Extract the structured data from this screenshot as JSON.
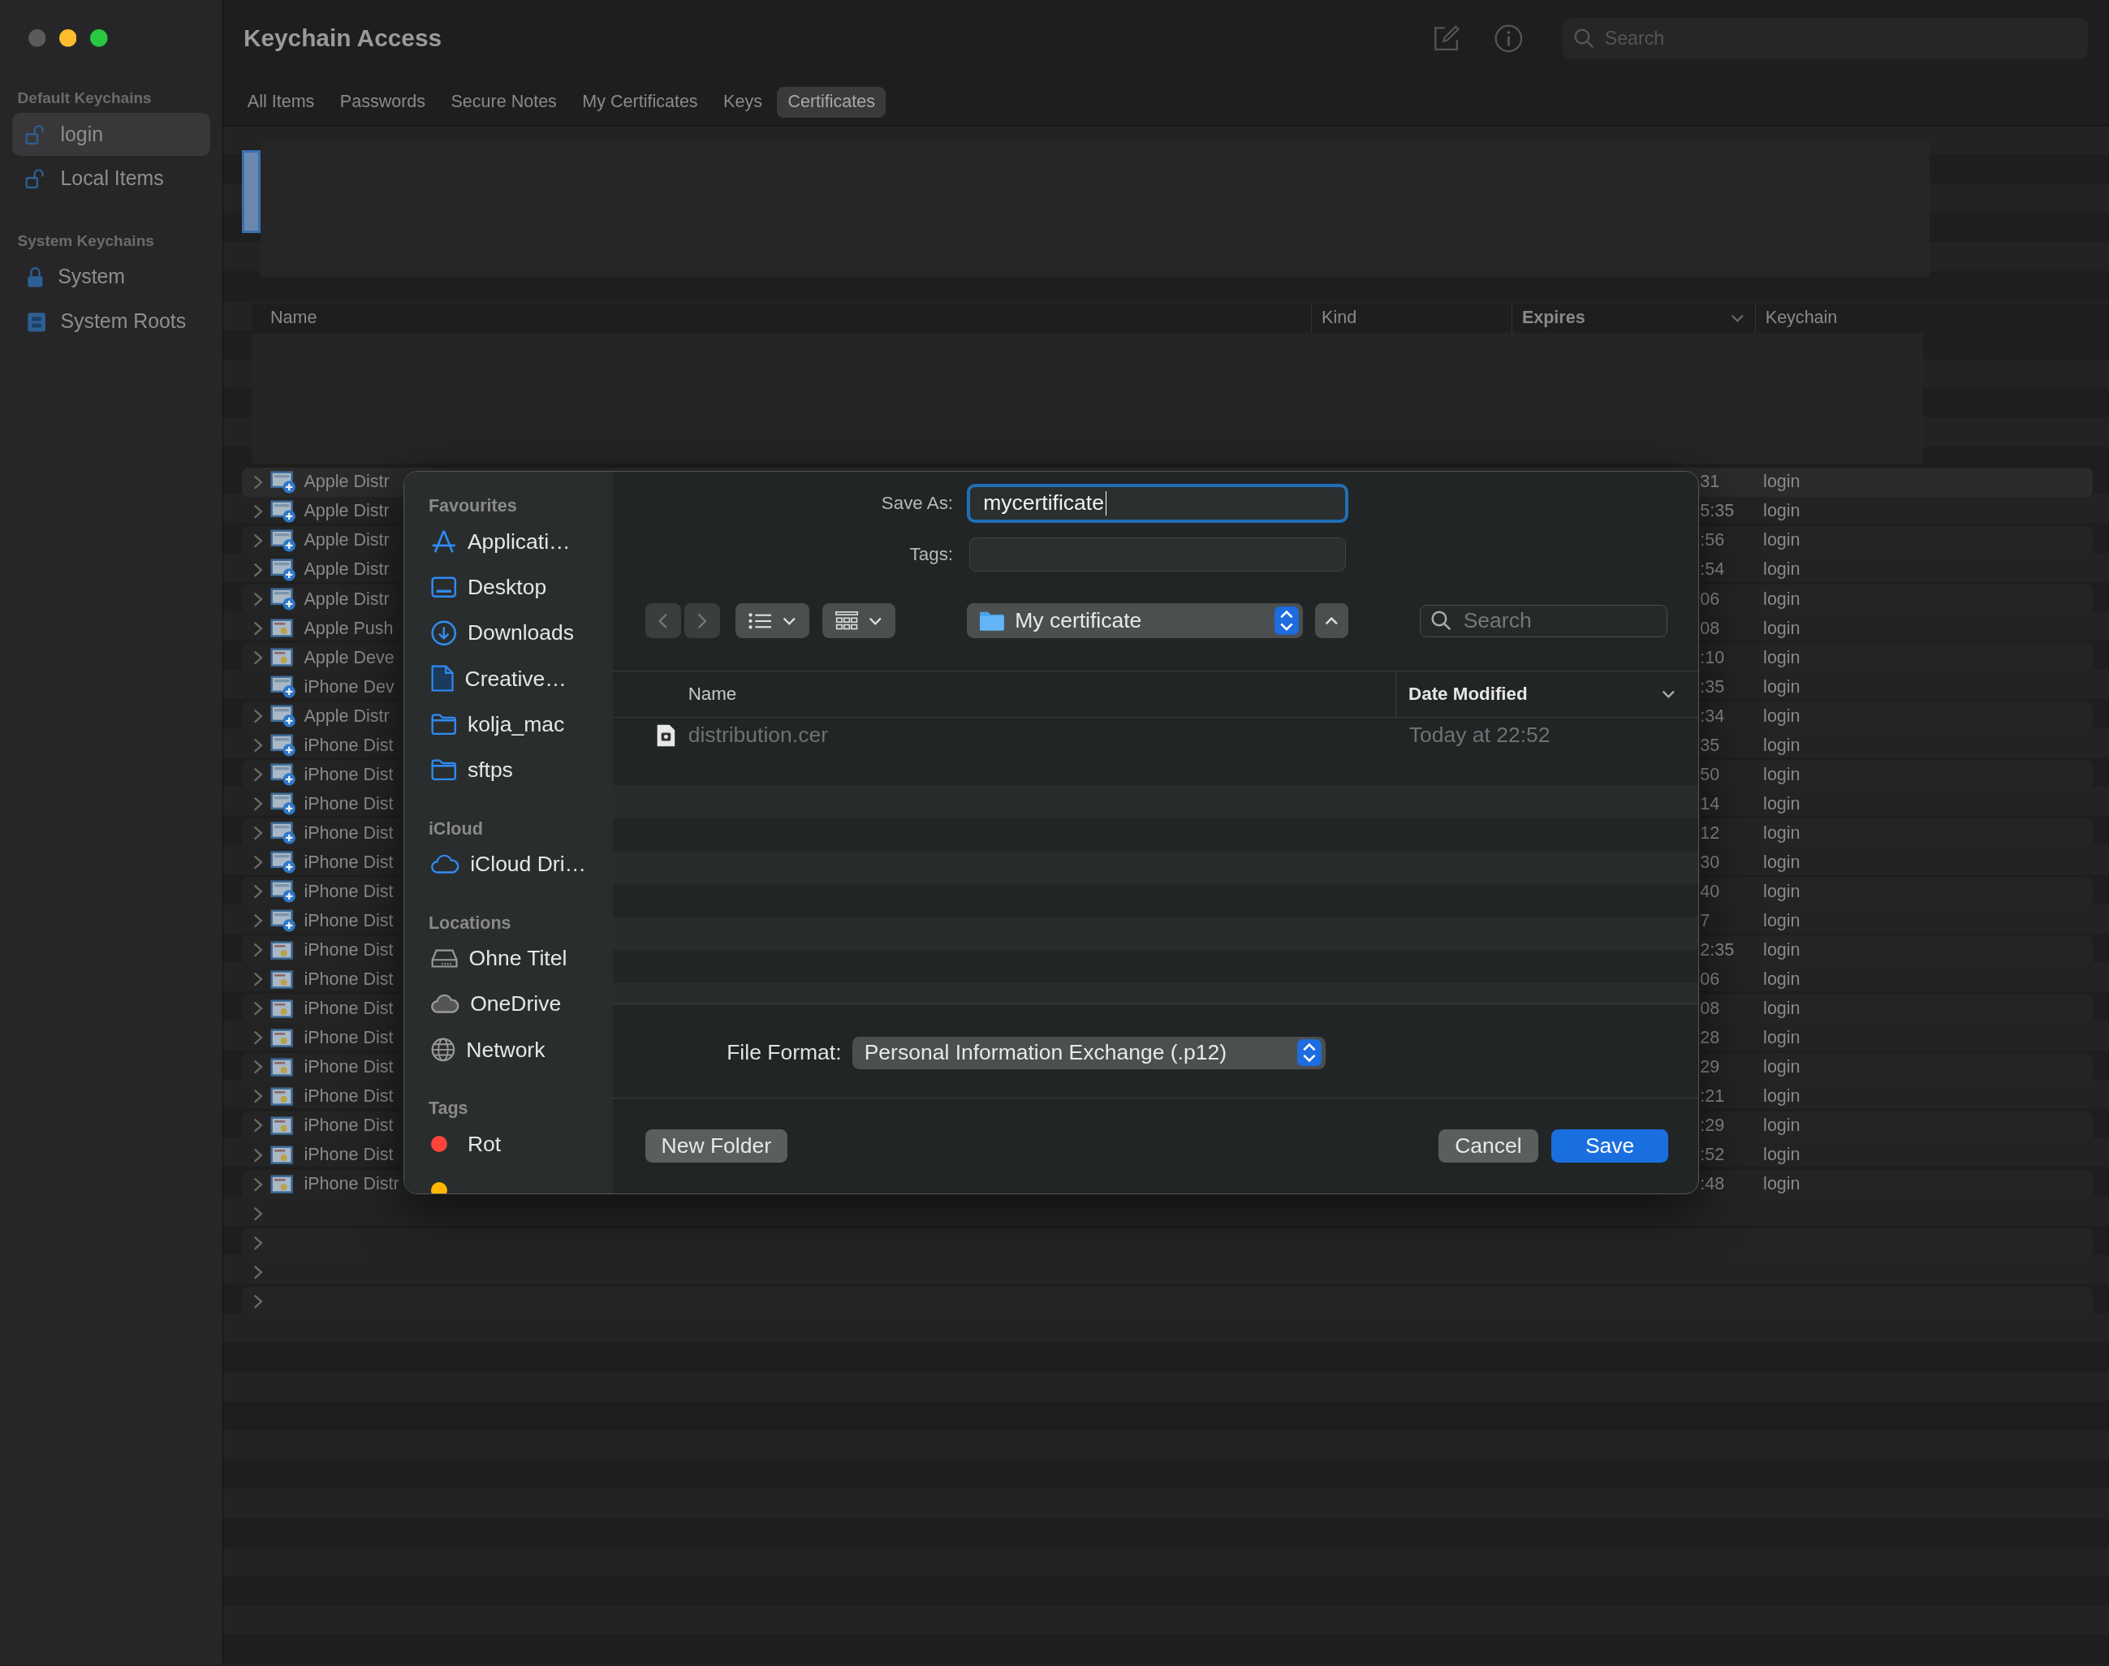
{
  "window": {
    "title": "Keychain Access"
  },
  "sidebar": {
    "sections": [
      {
        "title": "Default Keychains",
        "items": [
          {
            "label": "login",
            "selected": true
          },
          {
            "label": "Local Items",
            "selected": false
          }
        ]
      },
      {
        "title": "System Keychains",
        "items": [
          {
            "label": "System",
            "selected": false
          },
          {
            "label": "System Roots",
            "selected": false
          }
        ]
      }
    ]
  },
  "toolbar": {
    "search": {
      "placeholder": "Search"
    }
  },
  "tabs": [
    {
      "label": "All Items",
      "selected": false
    },
    {
      "label": "Passwords",
      "selected": false
    },
    {
      "label": "Secure Notes",
      "selected": false
    },
    {
      "label": "My Certificates",
      "selected": false
    },
    {
      "label": "Keys",
      "selected": false
    },
    {
      "label": "Certificates",
      "selected": true
    }
  ],
  "table": {
    "columns": [
      {
        "label": "Name",
        "sorted": false
      },
      {
        "label": "Kind",
        "sorted": false
      },
      {
        "label": "Expires",
        "sorted": true
      },
      {
        "label": "Keychain",
        "sorted": false
      }
    ],
    "rows": [
      {
        "kind": "identity",
        "expandable": true,
        "name": "Apple Distr",
        "expires": "31",
        "keychain": "login"
      },
      {
        "kind": "identity",
        "expandable": true,
        "name": "Apple Distr",
        "expires": "5:35",
        "keychain": "login"
      },
      {
        "kind": "identity",
        "expandable": true,
        "name": "Apple Distr",
        "expires": ":56",
        "keychain": "login"
      },
      {
        "kind": "identity",
        "expandable": true,
        "name": "Apple Distr",
        "expires": ":54",
        "keychain": "login"
      },
      {
        "kind": "identity",
        "expandable": true,
        "name": "Apple Distr",
        "expires": "06",
        "keychain": "login"
      },
      {
        "kind": "certificate",
        "expandable": true,
        "name": "Apple Push",
        "expires": "08",
        "keychain": "login"
      },
      {
        "kind": "certificate",
        "expandable": true,
        "name": "Apple Deve",
        "expires": ":10",
        "keychain": "login"
      },
      {
        "kind": "identity",
        "expandable": false,
        "name": "iPhone Dev",
        "expires": ":35",
        "keychain": "login"
      },
      {
        "kind": "identity",
        "expandable": true,
        "name": "Apple Distr",
        "expires": ":34",
        "keychain": "login"
      },
      {
        "kind": "identity",
        "expandable": true,
        "name": "iPhone Dist",
        "expires": "35",
        "keychain": "login"
      },
      {
        "kind": "identity",
        "expandable": true,
        "name": "iPhone Dist",
        "expires": "50",
        "keychain": "login"
      },
      {
        "kind": "identity",
        "expandable": true,
        "name": "iPhone Dist",
        "expires": "14",
        "keychain": "login"
      },
      {
        "kind": "identity",
        "expandable": true,
        "name": "iPhone Dist",
        "expires": "12",
        "keychain": "login"
      },
      {
        "kind": "identity",
        "expandable": true,
        "name": "iPhone Dist",
        "expires": "30",
        "keychain": "login"
      },
      {
        "kind": "identity",
        "expandable": true,
        "name": "iPhone Dist",
        "expires": "40",
        "keychain": "login"
      },
      {
        "kind": "identity",
        "expandable": true,
        "name": "iPhone Dist",
        "expires": "7",
        "keychain": "login"
      },
      {
        "kind": "certificate",
        "expandable": true,
        "name": "iPhone Dist",
        "expires": "2:35",
        "keychain": "login"
      },
      {
        "kind": "certificate",
        "expandable": true,
        "name": "iPhone Dist",
        "expires": "06",
        "keychain": "login"
      },
      {
        "kind": "certificate",
        "expandable": true,
        "name": "iPhone Dist",
        "expires": "08",
        "keychain": "login"
      },
      {
        "kind": "certificate",
        "expandable": true,
        "name": "iPhone Dist",
        "expires": "28",
        "keychain": "login"
      },
      {
        "kind": "certificate",
        "expandable": true,
        "name": "iPhone Dist",
        "expires": "29",
        "keychain": "login"
      },
      {
        "kind": "certificate",
        "expandable": true,
        "name": "iPhone Dist",
        "expires": ":21",
        "keychain": "login"
      },
      {
        "kind": "certificate",
        "expandable": true,
        "name": "iPhone Dist",
        "expires": ":29",
        "keychain": "login"
      },
      {
        "kind": "certificate",
        "expandable": true,
        "name": "iPhone Dist",
        "expires": ":52",
        "keychain": "login"
      },
      {
        "kind": "certificate",
        "expandable": true,
        "name": "iPhone Distr",
        "expires": ":48",
        "keychain": "login"
      },
      {
        "kind": "empty",
        "expandable": true
      },
      {
        "kind": "empty",
        "expandable": true
      },
      {
        "kind": "empty",
        "expandable": true
      },
      {
        "kind": "empty",
        "expandable": true
      }
    ]
  },
  "dialog": {
    "sidebar": {
      "sections": [
        {
          "title": "Favourites",
          "items": [
            {
              "label": "Applicati…"
            },
            {
              "label": "Desktop"
            },
            {
              "label": "Downloads"
            },
            {
              "label": "Creative…"
            },
            {
              "label": "kolja_mac"
            },
            {
              "label": "sftps"
            }
          ]
        },
        {
          "title": "iCloud",
          "items": [
            {
              "label": "iCloud Dri…"
            }
          ]
        },
        {
          "title": "Locations",
          "items": [
            {
              "label": "Ohne Titel"
            },
            {
              "label": "OneDrive"
            },
            {
              "label": "Network"
            }
          ]
        },
        {
          "title": "Tags",
          "items": [
            {
              "label": "Rot",
              "color": "#ff453a"
            },
            {
              "color": "#ffb800"
            }
          ]
        }
      ]
    },
    "save_as": {
      "label": "Save As:",
      "value": "mycertificate",
      "focused": true
    },
    "tags": {
      "label": "Tags:"
    },
    "location": {
      "label": "My certificate"
    },
    "search": {
      "placeholder": "Search"
    },
    "file_list": {
      "columns": [
        {
          "label": "Name",
          "sorted": false
        },
        {
          "label": "Date Modified",
          "sorted": true
        }
      ],
      "rows": [
        {
          "name": "distribution.cer",
          "modified": "Today at 22:52",
          "disabled": true
        }
      ]
    },
    "file_format": {
      "label": "File Format:",
      "value": "Personal Information Exchange (.p12)"
    },
    "buttons": [
      {
        "label": "New Folder",
        "kind": "secondary"
      },
      {
        "label": "Cancel",
        "kind": "secondary"
      },
      {
        "label": "Save",
        "kind": "default"
      }
    ]
  }
}
